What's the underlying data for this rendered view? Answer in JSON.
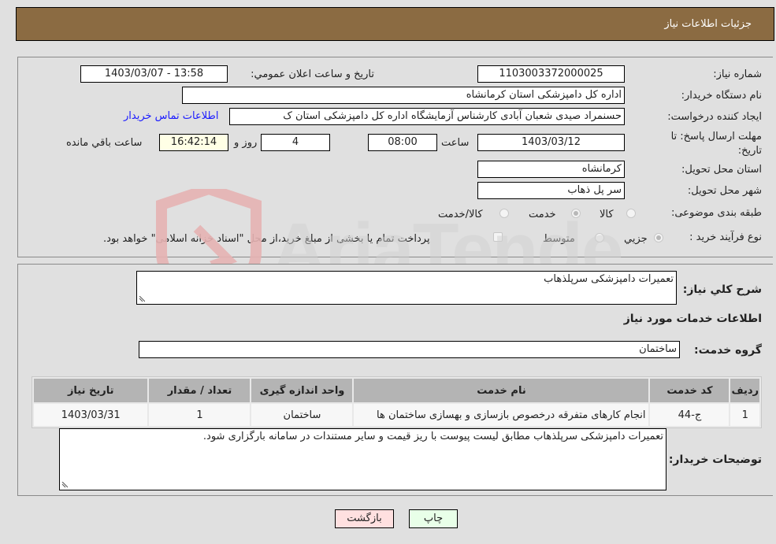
{
  "header": {
    "title": "جزئيات اطلاعات نياز"
  },
  "form": {
    "need_number": {
      "label": "شماره نياز:",
      "value": "1103003372000025"
    },
    "announce_datetime": {
      "label": "تاريخ و ساعت اعلان عمومي:",
      "value": "1403/03/07 - 13:58"
    },
    "buyer_org": {
      "label": "نام دستگاه خريدار:",
      "value": "اداره کل دامپزشکی استان کرمانشاه"
    },
    "requester": {
      "label": "ایجاد کننده درخواست:",
      "value": "حسنمراد صیدی شعبان آبادی کارشناس آزمایشگاه اداره کل دامپزشکی استان ک"
    },
    "buyer_contact_link": "اطلاعات تماس خريدار",
    "deadline": {
      "label": "مهلت ارسال پاسخ: تا تاریخ:",
      "date": "1403/03/12",
      "time_label": "ساعت",
      "time": "08:00",
      "days": "4",
      "days_label": "روز و",
      "remaining": "16:42:14",
      "remaining_label": "ساعت باقي مانده"
    },
    "delivery_province": {
      "label": "استان محل تحويل:",
      "value": "کرمانشاه"
    },
    "delivery_city": {
      "label": "شهر محل تحويل:",
      "value": "سر پل ذهاب"
    },
    "category": {
      "label": "طبقه بندی موضوعی:",
      "options": [
        "کالا",
        "خدمت",
        "کالا/خدمت"
      ],
      "selected": "خدمت"
    },
    "purchase_type": {
      "label": "نوع فرآيند خريد :",
      "options": [
        "جزيي",
        "متوسط"
      ],
      "selected": "جزيي",
      "treasury_note": "پرداخت تمام يا بخشی از مبلغ خريد،از محل \"اسناد خزانه اسلامی\" خواهد بود."
    }
  },
  "details": {
    "summary_label": "شرح کلي نياز:",
    "summary_value": "تعميرات دامپزشکی سرپلذهاب",
    "services_heading": "اطلاعات خدمات مورد نياز",
    "service_group_label": "گروه خدمت:",
    "service_group_value": "ساختمان",
    "table": {
      "headers": [
        "رديف",
        "کد خدمت",
        "نام خدمت",
        "واحد اندازه گيری",
        "تعداد / مقدار",
        "تاريخ نياز"
      ],
      "rows": [
        [
          "1",
          "ج-44",
          "انجام کارهای متفرقه درخصوص بازسازی و بهسازی ساختمان ها",
          "ساختمان",
          "1",
          "1403/03/31"
        ]
      ]
    },
    "buyer_notes_label": "توضيحات خريدار:",
    "buyer_notes_value": "تعمیرات دامپزشکی سرپلذهاب مطابق لیست پیوست با ریز قیمت و سایر مستندات در سامانه بارگزاری شود."
  },
  "buttons": {
    "print": "چاپ",
    "back": "بازگشت"
  },
  "watermark": {
    "text": "AriaTender.neT"
  },
  "colors": {
    "header_bg": "#8b6b42",
    "link": "#1a1aff",
    "print_bg": "#e8ffe8",
    "back_bg": "#ffe0e0"
  }
}
